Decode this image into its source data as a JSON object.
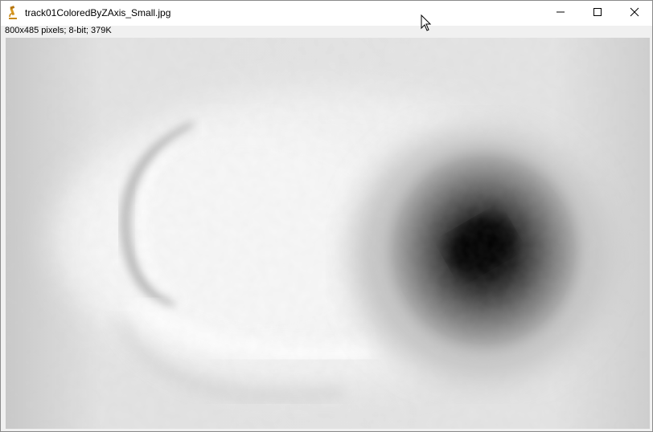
{
  "window": {
    "title": "track01ColoredByZAxis_Small.jpg",
    "info": "800x485 pixels; 8-bit; 379K",
    "icons": {
      "app": "microscope-icon",
      "minimize": "minimize-icon",
      "maximize": "maximize-icon",
      "close": "close-icon"
    }
  },
  "image": {
    "description_icon": "grayscale-depth-image",
    "colors": {
      "light": "#f4f4f4",
      "mid": "#bdbdbd",
      "dark": "#000000"
    }
  }
}
